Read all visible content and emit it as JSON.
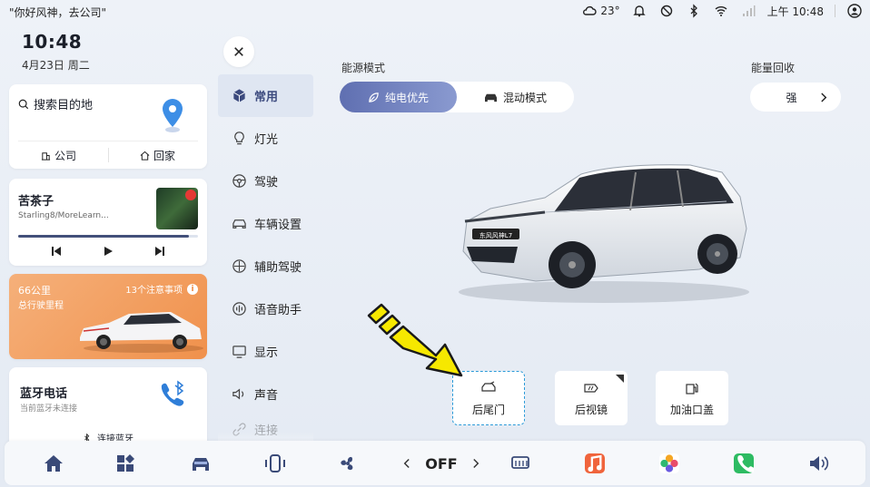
{
  "status_bar": {
    "voice_hint": "\"你好风神，去公司\"",
    "temperature": "23°",
    "time": "上午 10:48"
  },
  "left_panel": {
    "clock": "10:48",
    "date": "4月23日 周二",
    "navigation": {
      "search_label": "搜索目的地",
      "work_label": "公司",
      "home_label": "回家"
    },
    "music": {
      "title": "苦茶子",
      "artist": "Starling8/MoreLearn...",
      "progress_fraction": 0.95
    },
    "range": {
      "value": "66公里",
      "label": "总行驶里程",
      "notice": "13个注意事项",
      "notice_icon": "i"
    },
    "bluetooth": {
      "title": "蓝牙电话",
      "status": "当前蓝牙未连接",
      "connect_label": "连接蓝牙"
    }
  },
  "settings_menu": {
    "items": [
      {
        "label": "常用",
        "icon": "cube-icon",
        "active": true
      },
      {
        "label": "灯光",
        "icon": "bulb-icon",
        "active": false
      },
      {
        "label": "驾驶",
        "icon": "steering-wheel-icon",
        "active": false
      },
      {
        "label": "车辆设置",
        "icon": "car-icon",
        "active": false
      },
      {
        "label": "辅助驾驶",
        "icon": "assist-icon",
        "active": false
      },
      {
        "label": "语音助手",
        "icon": "voice-icon",
        "active": false
      },
      {
        "label": "显示",
        "icon": "display-icon",
        "active": false
      },
      {
        "label": "声音",
        "icon": "speaker-icon",
        "active": false
      },
      {
        "label": "连接",
        "icon": "link-icon",
        "active": false
      }
    ]
  },
  "main": {
    "energy_mode": {
      "label": "能源模式",
      "options": [
        "纯电优先",
        "混动模式"
      ],
      "selected": "纯电优先"
    },
    "regen": {
      "label": "能量回收",
      "value": "强"
    },
    "car_plate": "东风风神L7",
    "quick_actions": [
      {
        "label": "后尾门",
        "icon": "tailgate-icon",
        "highlighted": true
      },
      {
        "label": "后视镜",
        "icon": "mirror-icon",
        "highlighted": false
      },
      {
        "label": "加油口盖",
        "icon": "fuel-door-icon",
        "highlighted": false
      }
    ]
  },
  "dock": {
    "fan_speed": "OFF",
    "colors": {
      "music_app": "#f0643c",
      "phone_app": "#2dbb62",
      "accent": "#5f6fb1"
    }
  }
}
